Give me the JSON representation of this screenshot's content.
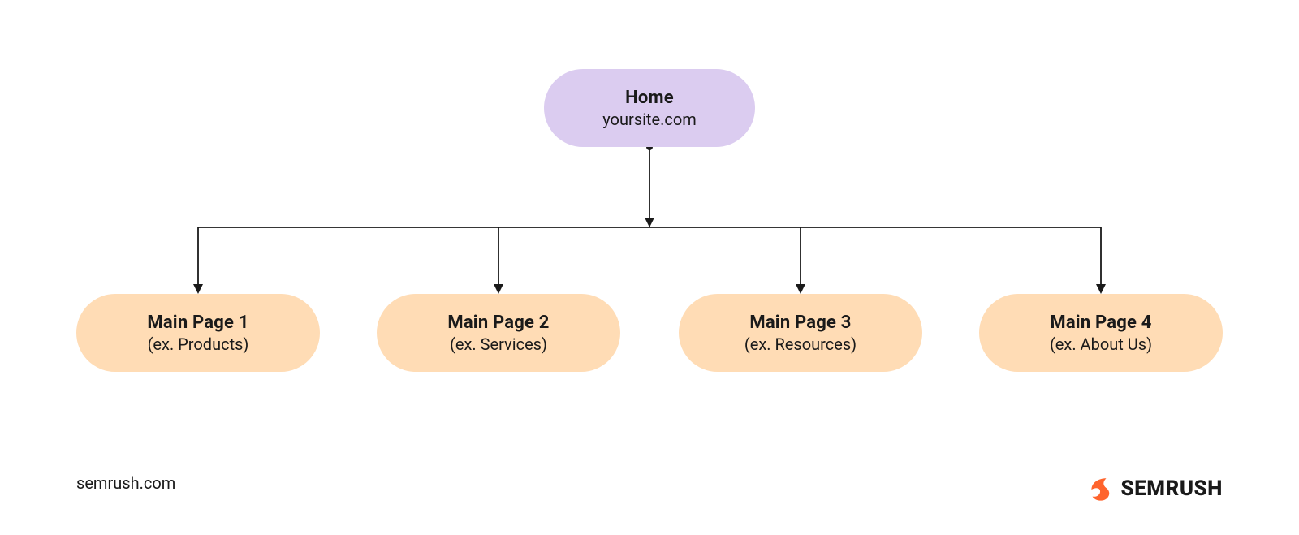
{
  "root": {
    "title": "Home",
    "subtitle": "yoursite.com"
  },
  "children": [
    {
      "title": "Main Page 1",
      "subtitle": "(ex. Products)"
    },
    {
      "title": "Main Page 2",
      "subtitle": "(ex. Services)"
    },
    {
      "title": "Main Page 3",
      "subtitle": "(ex. Resources)"
    },
    {
      "title": "Main Page 4",
      "subtitle": "(ex. About Us)"
    }
  ],
  "footer": {
    "site": "semrush.com",
    "brand": "SEMRUSH"
  },
  "colors": {
    "root_bg": "#dbccf0",
    "child_bg": "#ffdcb5",
    "line": "#1a1a1a",
    "brand_orange": "#ff642d"
  }
}
